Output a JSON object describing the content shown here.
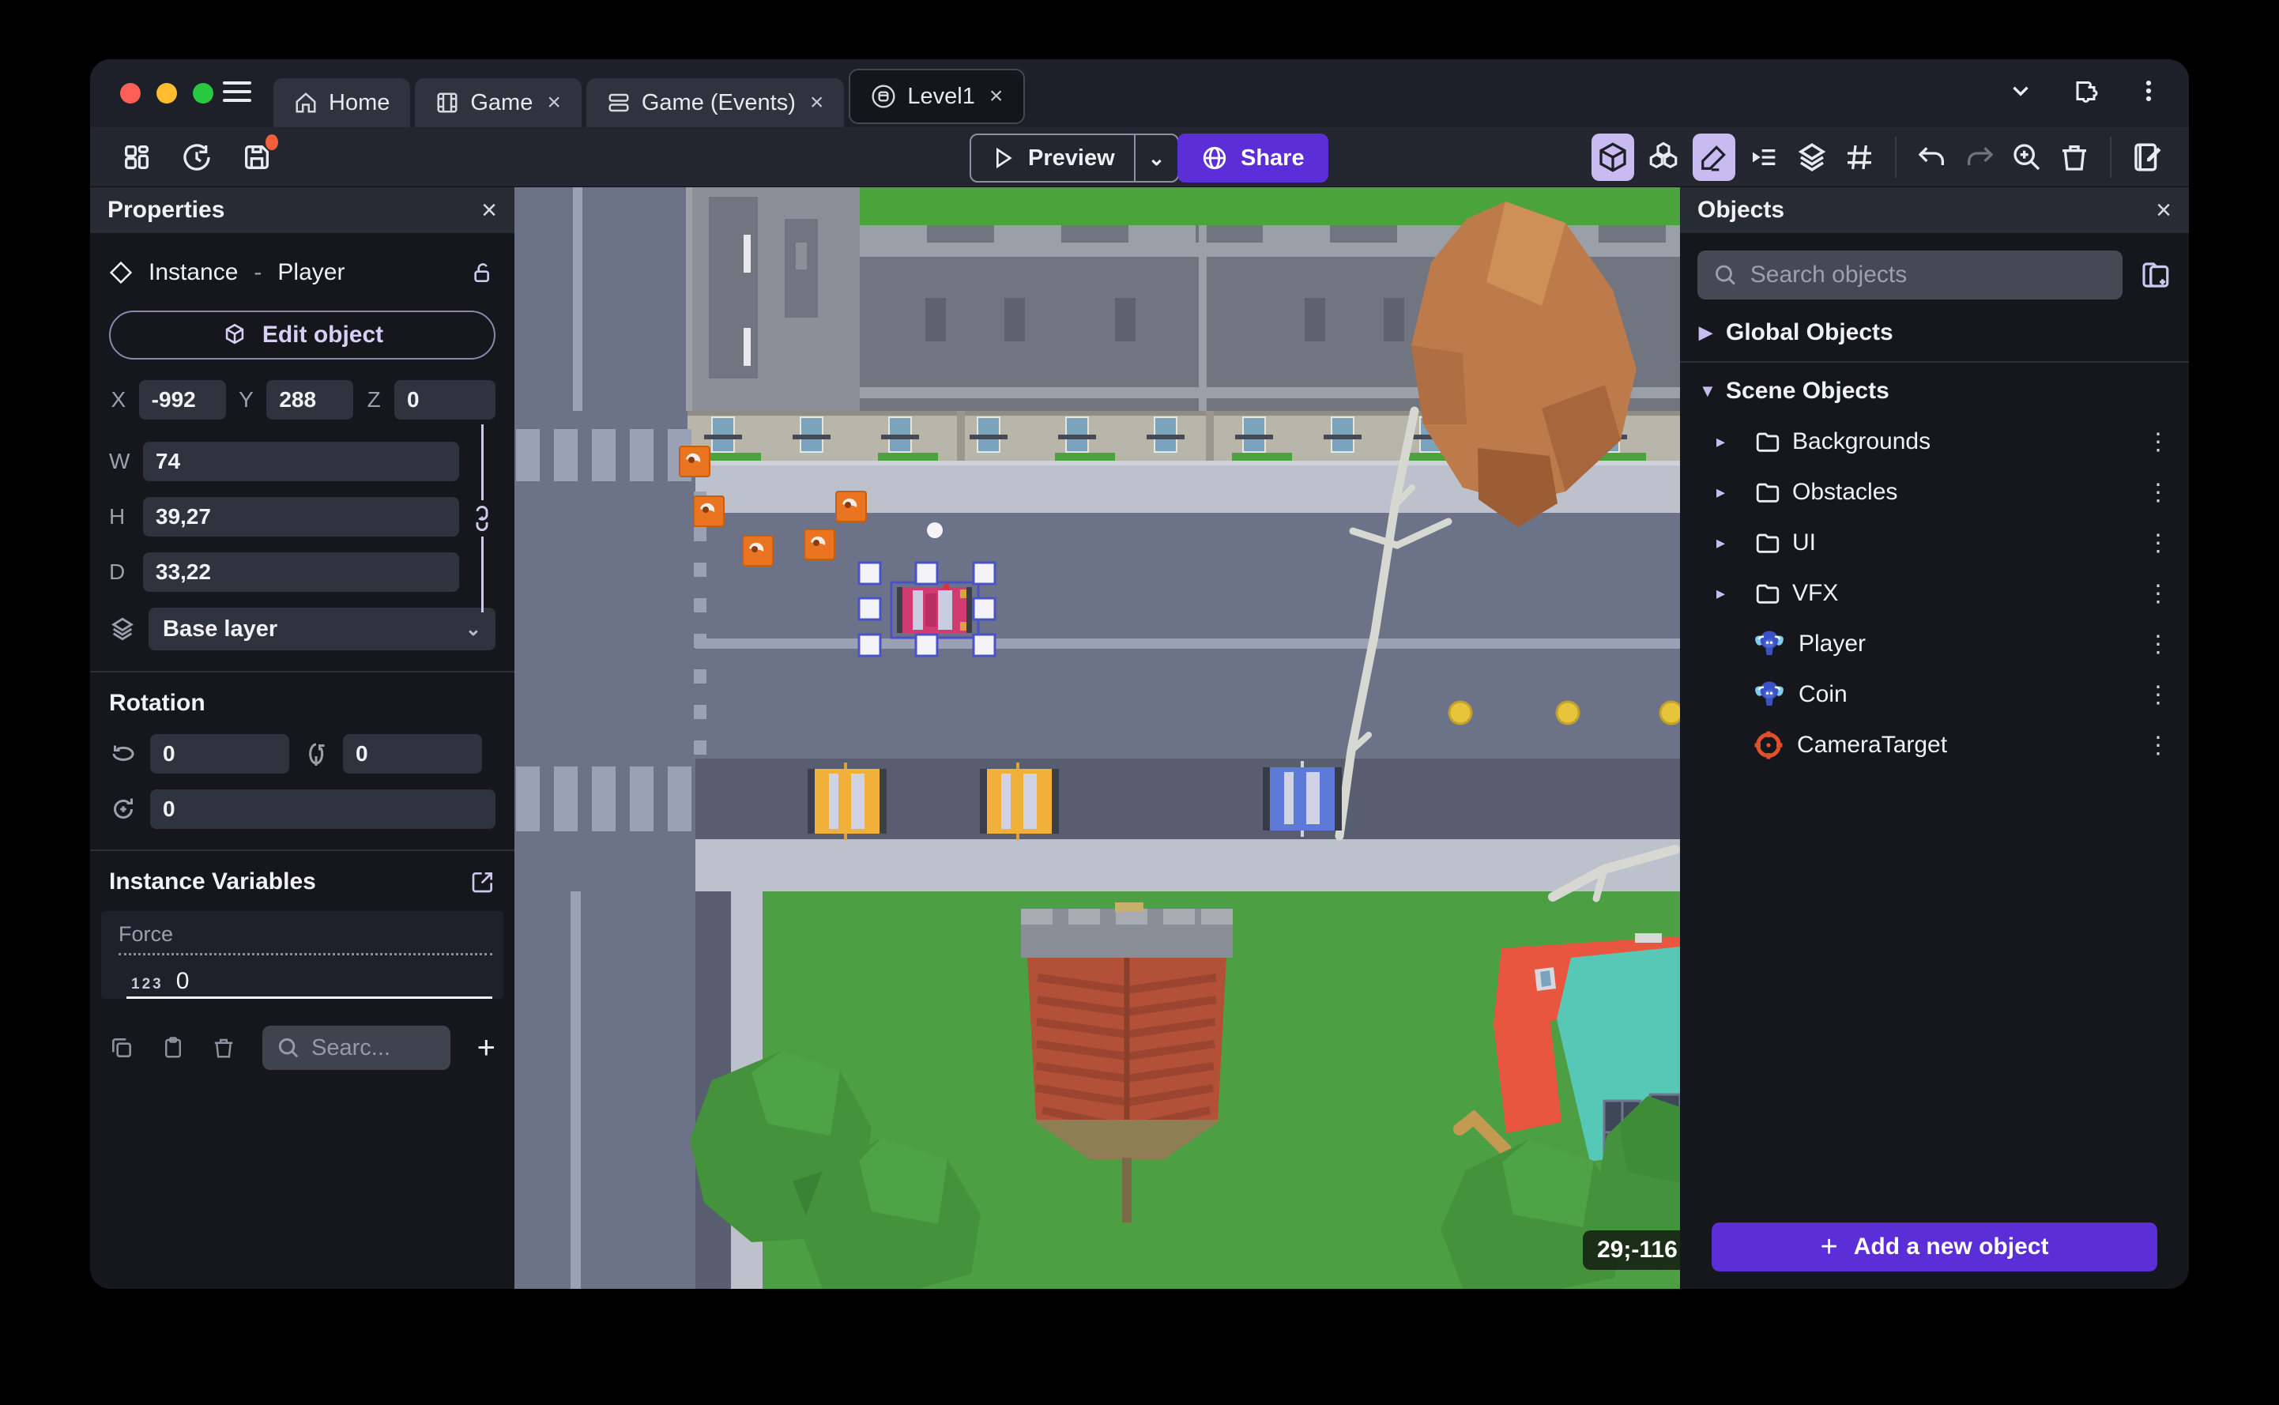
{
  "window": {
    "tabs": [
      {
        "label": "Home"
      },
      {
        "label": "Game",
        "close": "×"
      },
      {
        "label": "Game (Events)",
        "close": "×"
      },
      {
        "label": "Level1",
        "close": "×"
      }
    ]
  },
  "toolbar": {
    "preview_label": "Preview",
    "share_label": "Share"
  },
  "properties_panel": {
    "title": "Properties",
    "close": "×",
    "instance_type": "Instance",
    "separator": "-",
    "object_name": "Player",
    "edit_object_label": "Edit object",
    "x_label": "X",
    "x_value": "-992",
    "y_label": "Y",
    "y_value": "288",
    "z_label": "Z",
    "z_value": "0",
    "w_label": "W",
    "w_value": "74",
    "h_label": "H",
    "h_value": "39,27",
    "d_label": "D",
    "d_value": "33,22",
    "layer_value": "Base layer",
    "rotation_title": "Rotation",
    "rot_x_value": "0",
    "rot_y_value": "0",
    "rot_z_value": "0",
    "variables_title": "Instance Variables",
    "variable_name": "Force",
    "variable_type_badge": "123",
    "variable_value": "0",
    "search_placeholder": "Searc..."
  },
  "objects_panel": {
    "title": "Objects",
    "close": "×",
    "search_placeholder": "Search objects",
    "global_group_label": "Global Objects",
    "scene_group_label": "Scene Objects",
    "folders": [
      {
        "label": "Backgrounds"
      },
      {
        "label": "Obstacles"
      },
      {
        "label": "UI"
      },
      {
        "label": "VFX"
      }
    ],
    "objects": [
      {
        "label": "Player"
      },
      {
        "label": "Coin"
      },
      {
        "label": "CameraTarget"
      }
    ],
    "add_button_label": "Add a new object"
  },
  "canvas": {
    "coordinates_badge": "29;-116"
  },
  "colors": {
    "accent_purple": "#5b2ed8",
    "toolbar_highlight": "#c9bbf2",
    "traffic_red": "#ff5f57",
    "traffic_yellow": "#febc2e",
    "traffic_green": "#28c840",
    "road": "#6c7287",
    "grass": "#4d9f43",
    "selection_blue": "#4a52c8",
    "player_car_pink": "#d23b72",
    "camera_target_orange": "#e0502a"
  }
}
